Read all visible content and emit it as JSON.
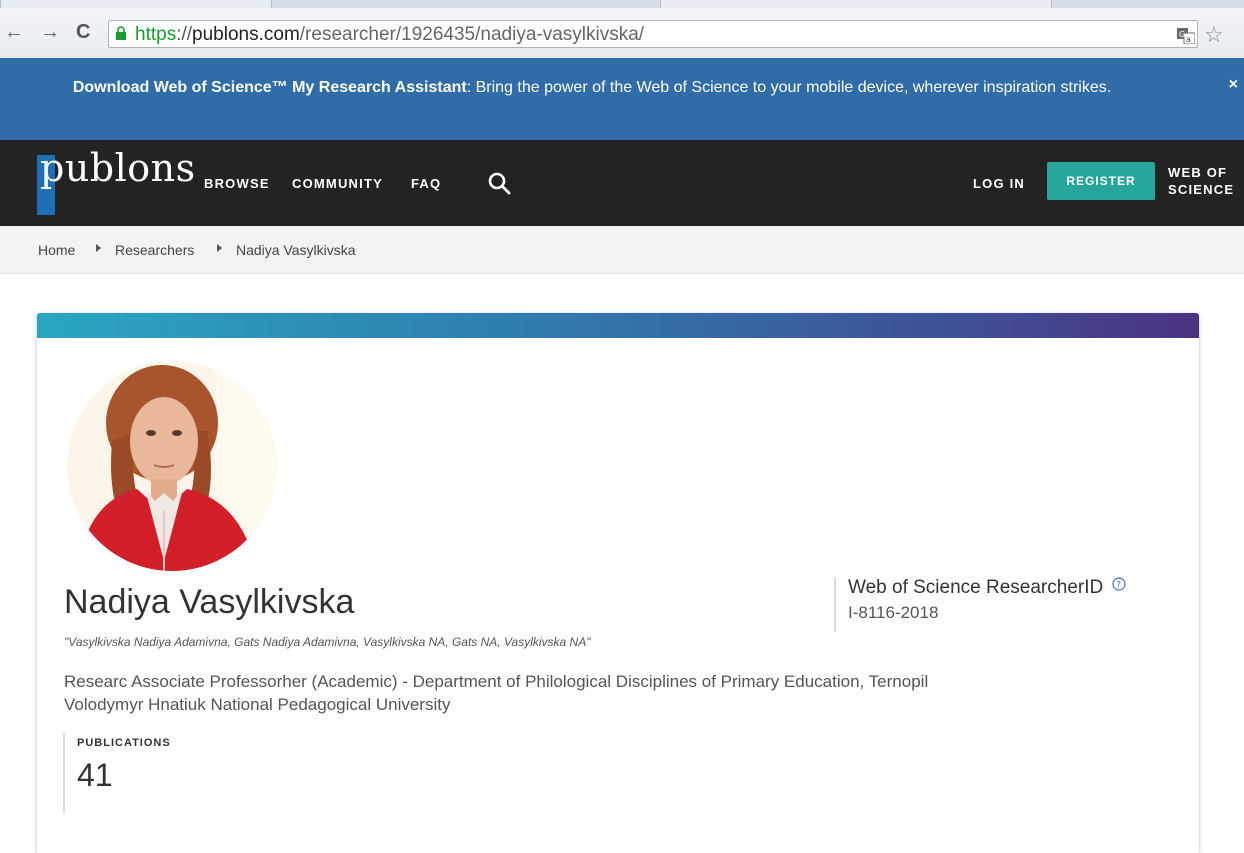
{
  "browser": {
    "url_scheme": "https",
    "url_sep": "://",
    "url_host": "publons.com",
    "url_path": "/researcher/1926435/nadiya-vasylkivska/",
    "back_glyph": "←",
    "forward_glyph": "→",
    "reload_glyph": "C",
    "star_glyph": "☆",
    "icons": [
      "back-arrow-icon",
      "forward-arrow-icon",
      "reload-icon",
      "lock-icon",
      "translate-icon",
      "star-icon"
    ]
  },
  "banner": {
    "bold_text": "Download Web of Science™ My Research Assistant",
    "text": ": Bring the power of the Web of Science to your mobile device, wherever inspiration strikes.",
    "close": "×"
  },
  "header": {
    "logo": "publons",
    "nav": [
      "BROWSE",
      "COMMUNITY",
      "FAQ"
    ],
    "login": "LOG IN",
    "register": "REGISTER",
    "wos_line1": "WEB OF",
    "wos_line2": "SCIENCE"
  },
  "breadcrumb": [
    "Home",
    "Researchers",
    "Nadiya Vasylkivska"
  ],
  "profile": {
    "name": "Nadiya Vasylkivska",
    "aliases": "\"Vasylkivska Nadiya Adamivna, Gats Nadiya Adamivna, Vasylkivska NA, Gats NA, Vasylkivska NA\"",
    "affiliation": "Researc Associate Professorher (Academic) - Department of Philological Disciplines of Primary Education, Ternopil Volodymyr Hnatiuk National Pedagogical University",
    "publications_label": "PUBLICATIONS",
    "publications_count": "41",
    "researcher_id_label": "Web of Science ResearcherID",
    "researcher_id": "I-8116-2018"
  },
  "colors": {
    "banner": "#2f6ca8",
    "header": "#232323",
    "register": "#26a69a",
    "logo_accent": "#1d6fb8"
  }
}
